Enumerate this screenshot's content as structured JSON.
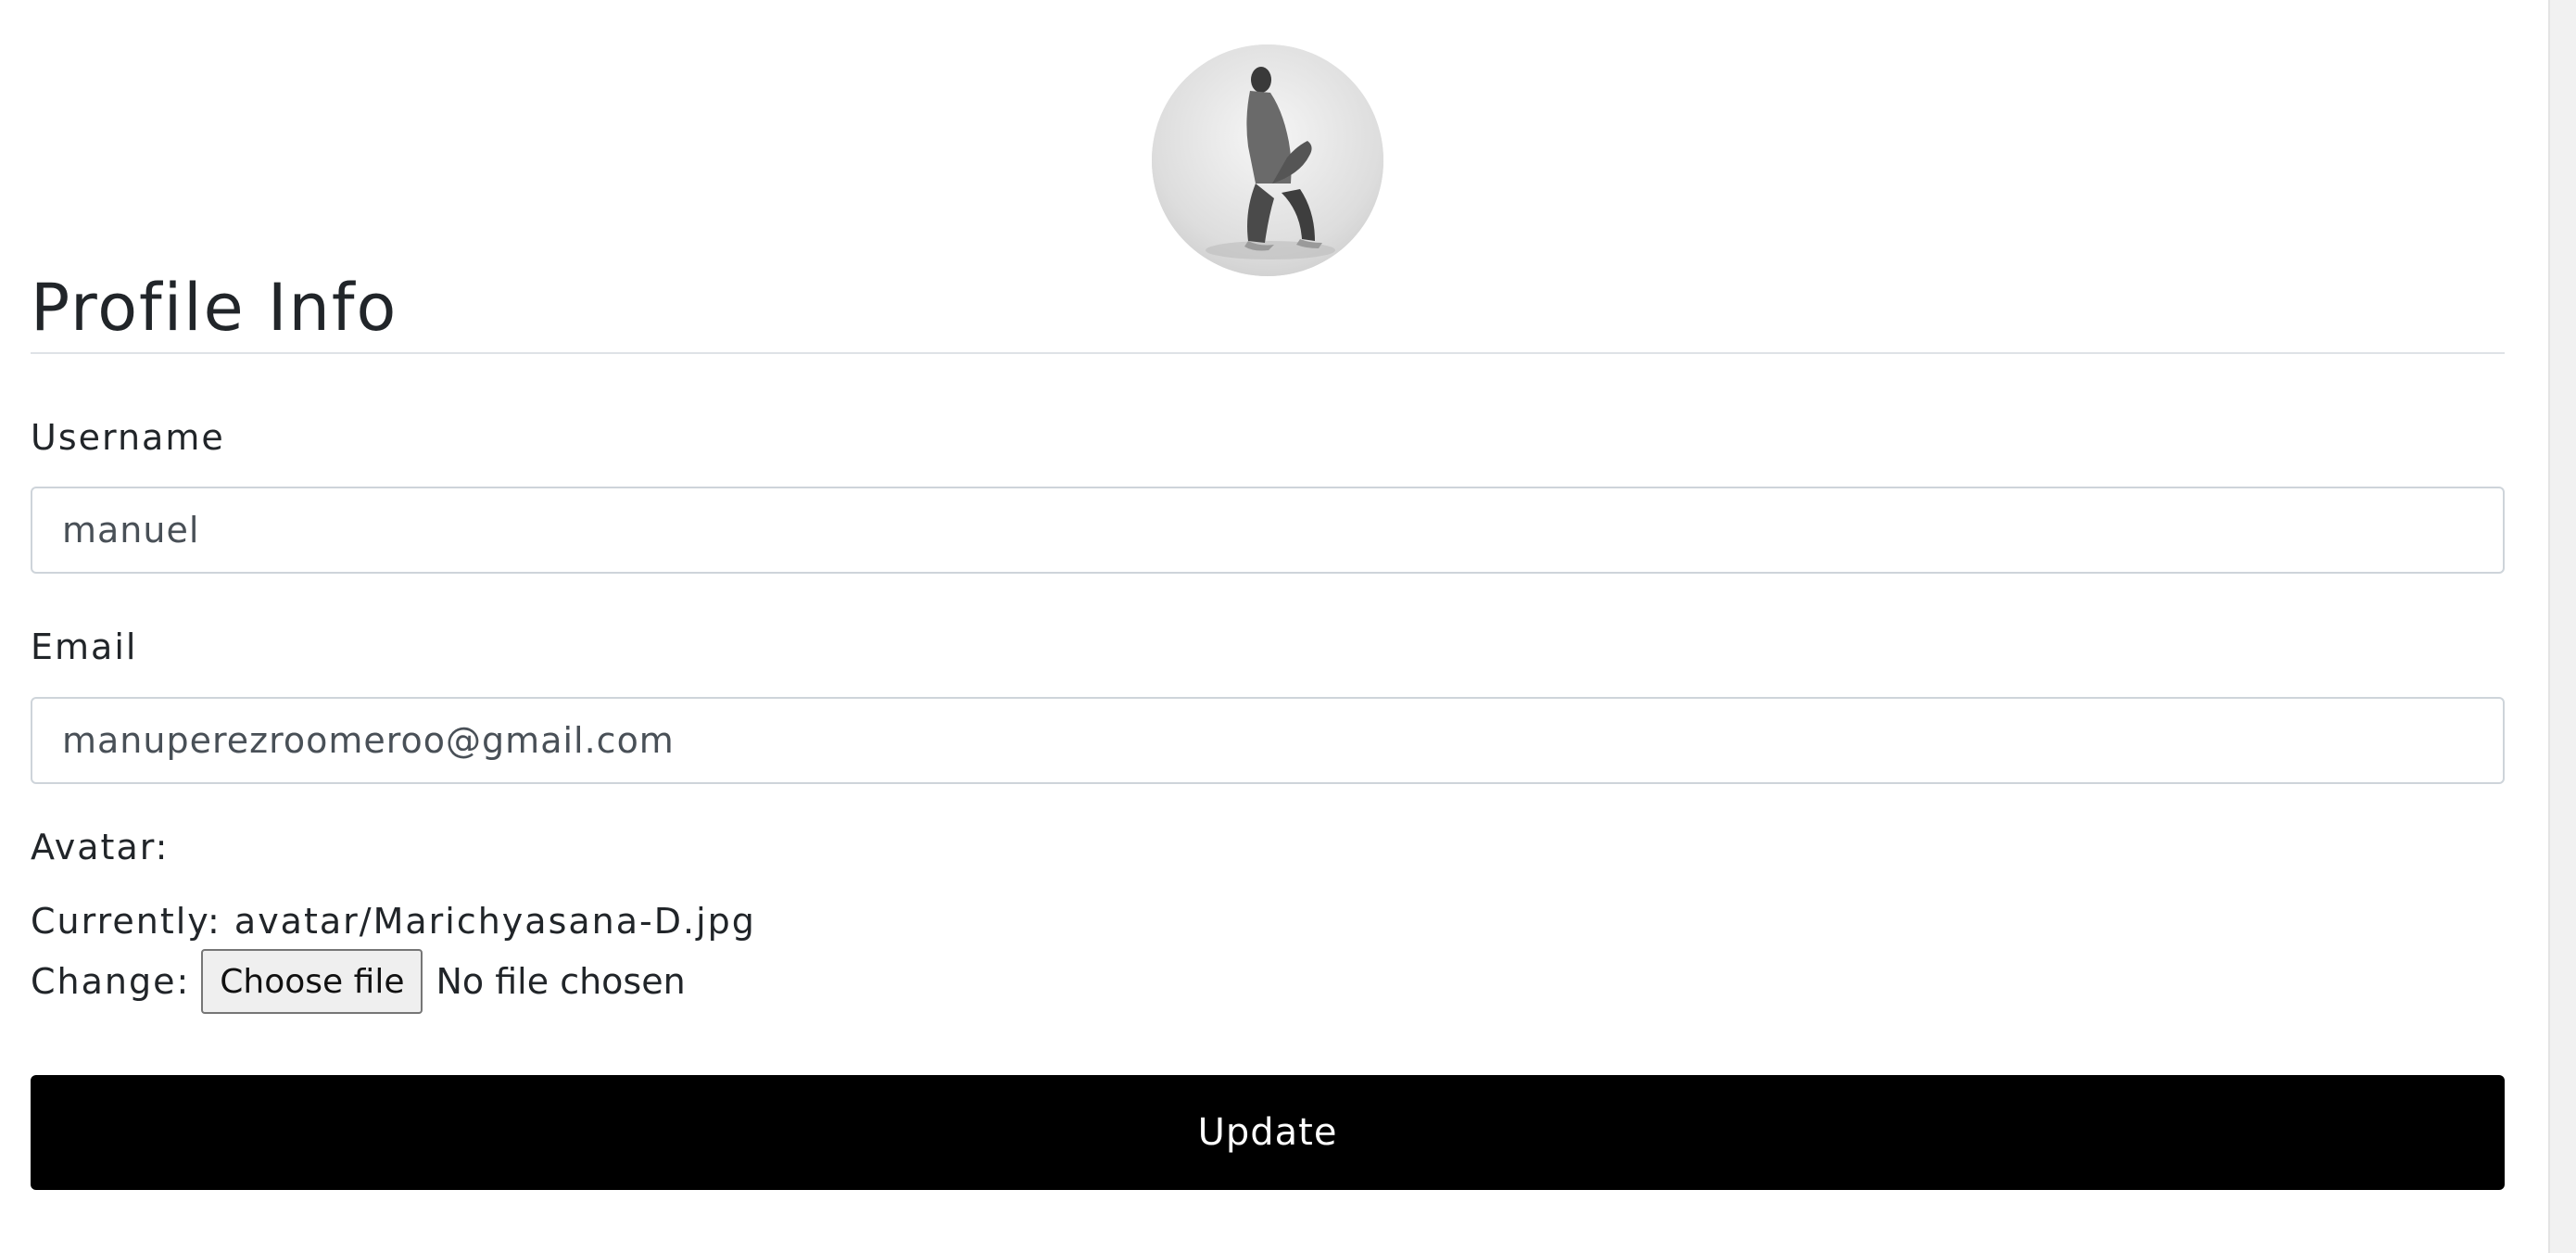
{
  "profile": {
    "avatar_alt": "avatar",
    "title": "Profile Info"
  },
  "form": {
    "username": {
      "label": "Username",
      "value": "manuel"
    },
    "email": {
      "label": "Email",
      "value": "manuperezroomeroo@gmail.com"
    },
    "avatar": {
      "label": "Avatar:",
      "currently_label": "Currently:",
      "current_file": "avatar/Marichyasana-D.jpg",
      "change_label": "Change:",
      "choose_button": "Choose file",
      "no_file_text": "No file chosen"
    },
    "submit_label": "Update"
  },
  "colors": {
    "button_bg": "#000000",
    "button_text": "#ffffff",
    "border": "#ced4da",
    "text": "#212529"
  }
}
